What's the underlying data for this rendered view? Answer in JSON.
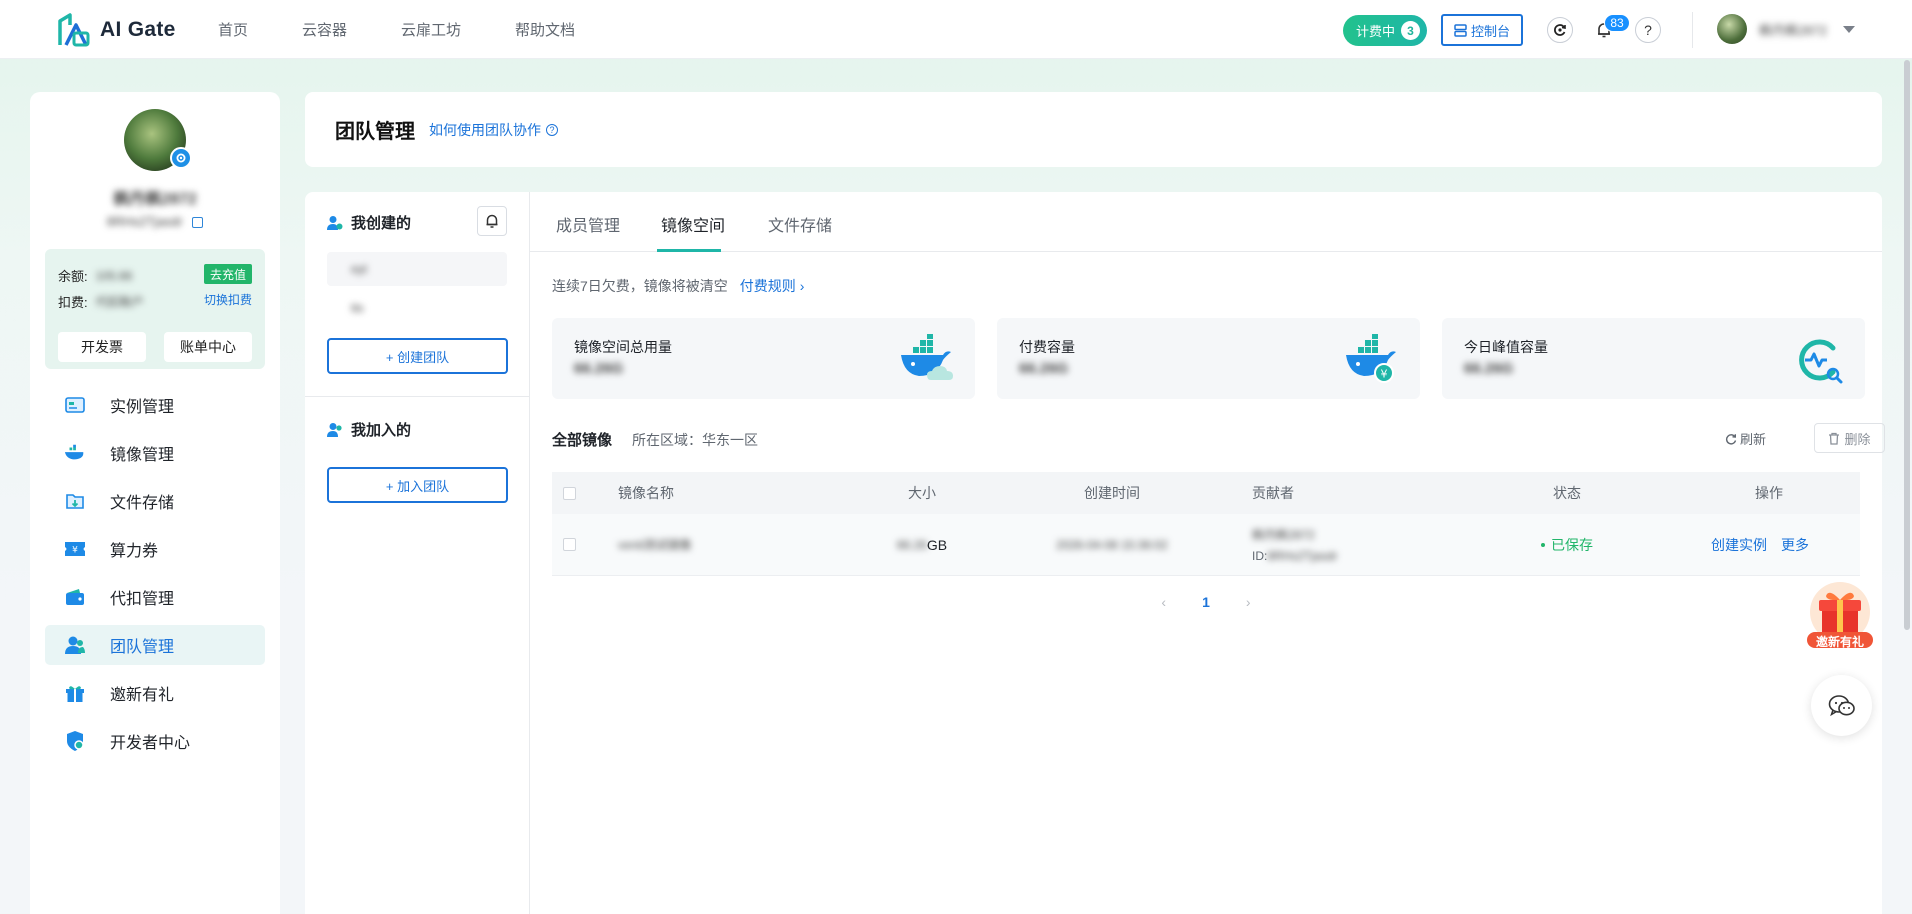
{
  "topbar": {
    "brand": "AI Gate",
    "nav": [
      "首页",
      "云容器",
      "云扉工坊",
      "帮助文档"
    ],
    "billing_label": "计费中",
    "billing_count": "3",
    "console_label": "控制台",
    "notification_count": "83",
    "help_glyph": "?",
    "username": "枫丹枫2872"
  },
  "profile": {
    "name": "枫丹枫2872",
    "user_id": "8RHs2Tjasdr"
  },
  "account": {
    "balance_label": "余额:",
    "balance_value": "105.66",
    "recharge_label": "去充值",
    "deduct_label": "扣费:",
    "deduct_value": "代扣账户",
    "switch_label": "切换扣费",
    "invoice_label": "开发票",
    "bill_center_label": "账单中心"
  },
  "menu": [
    {
      "label": "实例管理",
      "icon": "instance-icon"
    },
    {
      "label": "镜像管理",
      "icon": "docker-icon"
    },
    {
      "label": "文件存储",
      "icon": "storage-icon"
    },
    {
      "label": "算力券",
      "icon": "coupon-icon"
    },
    {
      "label": "代扣管理",
      "icon": "wallet-icon"
    },
    {
      "label": "团队管理",
      "icon": "team-icon"
    },
    {
      "label": "邀新有礼",
      "icon": "gift-icon"
    },
    {
      "label": "开发者中心",
      "icon": "shield-icon"
    }
  ],
  "header": {
    "title": "团队管理",
    "help_link": "如何使用团队协作"
  },
  "teams": {
    "created_title": "我创建的",
    "created_items": [
      "eyt",
      "tts"
    ],
    "create_button": "+ 创建团队",
    "joined_title": "我加入的",
    "join_button": "+ 加入团队"
  },
  "tabs": [
    "成员管理",
    "镜像空间",
    "文件存储"
  ],
  "notice": {
    "text": "连续7日欠费，镜像将被清空",
    "rule_link": "付费规则"
  },
  "stats": [
    {
      "label": "镜像空间总用量",
      "value": "66.26G",
      "icon": "docker-cloud-icon"
    },
    {
      "label": "付费容量",
      "value": "66.26G",
      "icon": "docker-yen-icon"
    },
    {
      "label": "今日峰值容量",
      "value": "66.26G",
      "icon": "peak-gauge-icon"
    }
  ],
  "list": {
    "title": "全部镜像",
    "region": "所在区域：华东一区",
    "refresh_label": "刷新",
    "delete_label": "删除"
  },
  "table": {
    "columns": [
      "镜像名称",
      "大小",
      "创建时间",
      "贡献者",
      "状态",
      "操作"
    ],
    "rows": [
      {
        "name": "venti测试镜像",
        "size_num": "66.26",
        "size_unit": "GB",
        "created": "2026-04-08 15:36:02",
        "contributor_name": "枫丹枫2872",
        "contributor_id_label": "ID:",
        "contributor_id": "8RHs2Tjasdr",
        "status": "已保存",
        "action_create": "创建实例",
        "action_more": "更多"
      }
    ]
  },
  "pagination": {
    "prev": "‹",
    "current": "1",
    "next": "›"
  },
  "floating": {
    "invite_label": "邀新有礼"
  },
  "colors": {
    "primary": "#1b73d9",
    "accent_green": "#22b56a",
    "teal": "#1fb6a8"
  }
}
